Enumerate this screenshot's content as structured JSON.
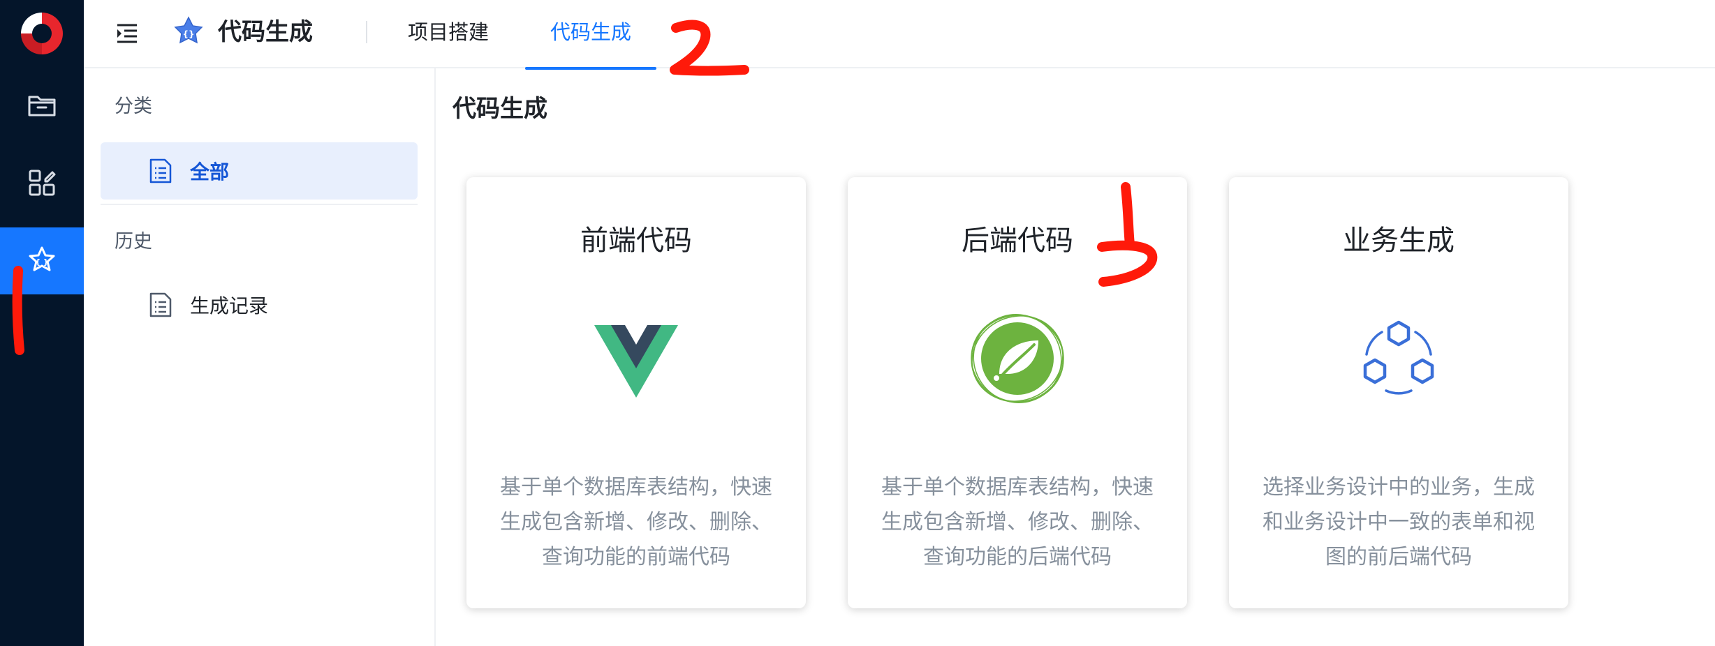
{
  "header": {
    "app_title": "代码生成",
    "tabs": [
      {
        "label": "项目搭建",
        "active": false
      },
      {
        "label": "代码生成",
        "active": true
      }
    ]
  },
  "rail": {
    "items": [
      "folder-icon",
      "apps-icon",
      "star-gear-icon"
    ],
    "active_index": 2
  },
  "subnav": {
    "group1": "分类",
    "item_all": "全部",
    "group2": "历史",
    "item_history": "生成记录"
  },
  "main": {
    "title": "代码生成",
    "cards": [
      {
        "title": "前端代码",
        "desc": "基于单个数据库表结构，快速生成包含新增、修改、删除、查询功能的前端代码",
        "icon": "vue-icon"
      },
      {
        "title": "后端代码",
        "desc": "基于单个数据库表结构，快速生成包含新增、修改、删除、查询功能的后端代码",
        "icon": "spring-icon"
      },
      {
        "title": "业务生成",
        "desc": "选择业务设计中的业务，生成和业务设计中一致的表单和视图的前后端代码",
        "icon": "hexagons-icon"
      }
    ]
  },
  "annotations": [
    "1",
    "2",
    "3"
  ],
  "colors": {
    "rail_bg": "#04152a",
    "accent": "#1677ff",
    "active_item_bg": "#e8effd",
    "annotation": "#ff1a0a"
  }
}
